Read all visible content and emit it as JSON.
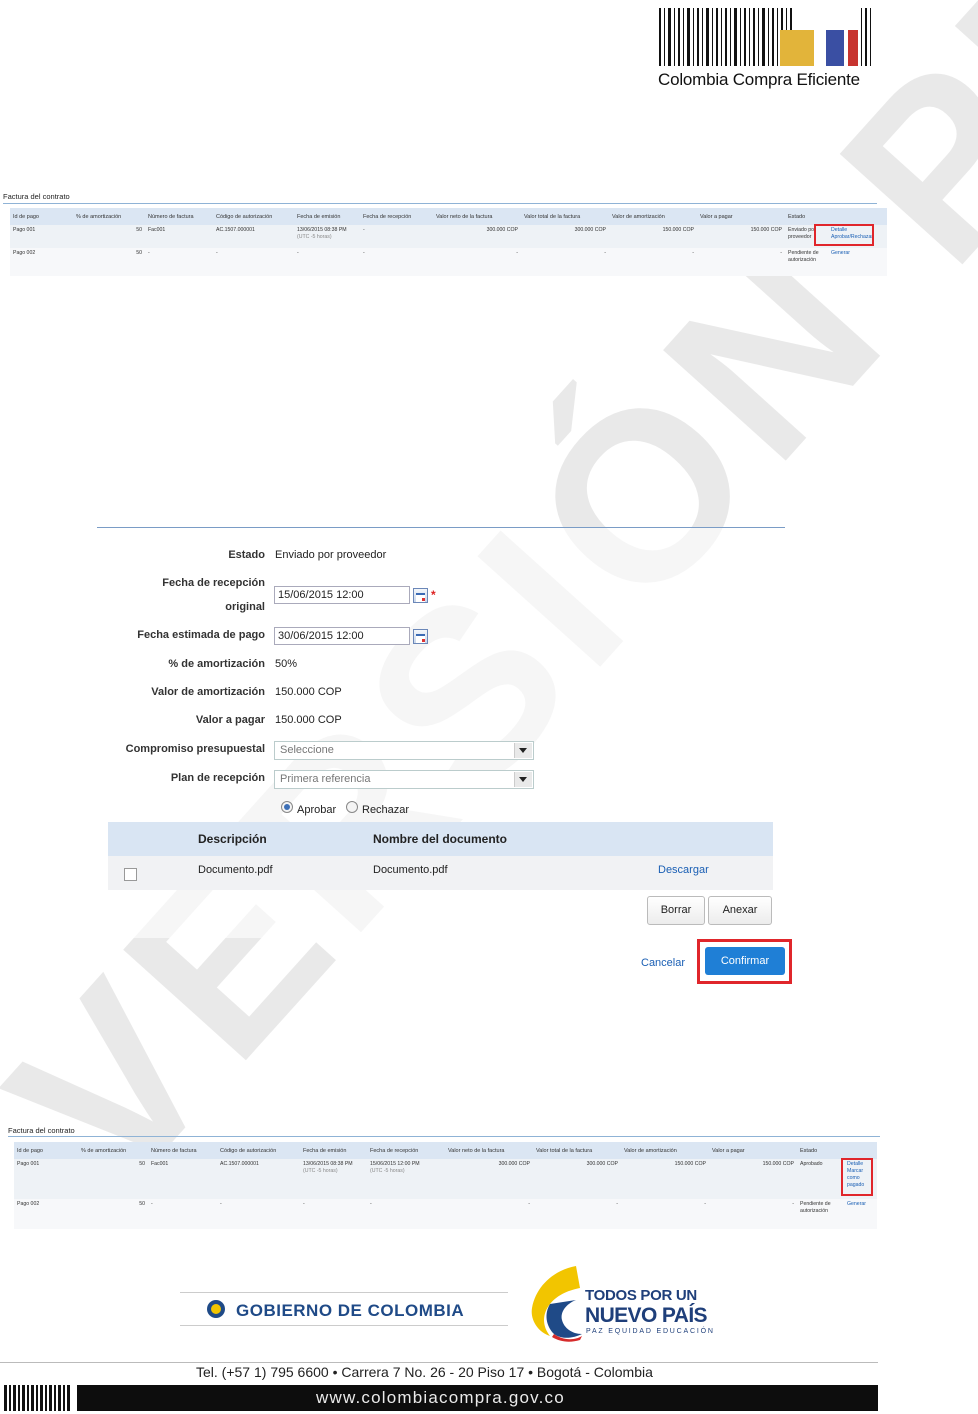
{
  "header": {
    "brand": "Colombia Compra Eficiente"
  },
  "table_before": {
    "title": "Factura del contrato",
    "columns": [
      "Id de pago",
      "% de amortización",
      "Número de factura",
      "Código de autorización",
      "Fecha de emisión",
      "Fecha de recepción",
      "Valor neto de la factura",
      "Valor total de la factura",
      "Valor de amortización",
      "Valor a pagar",
      "Estado"
    ],
    "rows": [
      {
        "id": "Pago 001",
        "pct": "50",
        "num": "Fac001",
        "code": "AC.1507.000001",
        "emision": "13/06/2015 08:38 PM",
        "emision_tz": "(UTC -5 horas)",
        "recepcion": "-",
        "neto": "300.000 COP",
        "total": "300.000 COP",
        "amort": "150.000 COP",
        "pagar": "150.000 COP",
        "estado": "Enviado por proveedor",
        "actions": [
          "Detalle",
          "Aprobar/Rechazar"
        ]
      },
      {
        "id": "Pago 002",
        "pct": "50",
        "num": "-",
        "code": "-",
        "emision": "-",
        "recepcion": "-",
        "neto": "-",
        "total": "-",
        "amort": "-",
        "pagar": "-",
        "estado": "Pendiente de autorización",
        "actions": [
          "Generar"
        ]
      }
    ]
  },
  "dialog": {
    "estado_label": "Estado",
    "estado_value": "Enviado por proveedor",
    "fecha_recepcion_label_1": "Fecha de recepción",
    "fecha_recepcion_label_2": "original",
    "fecha_recepcion_value": "15/06/2015 12:00",
    "required_mark": "*",
    "fecha_pago_label": "Fecha estimada de pago",
    "fecha_pago_value": "30/06/2015 12:00",
    "pct_label": "% de amortización",
    "pct_value": "50%",
    "amort_label": "Valor de amortización",
    "amort_value": "150.000 COP",
    "pagar_label": "Valor a pagar",
    "pagar_value": "150.000 COP",
    "compromiso_label": "Compromiso presupuestal",
    "compromiso_value": "Seleccione",
    "plan_label": "Plan de recepción",
    "plan_value": "Primera referencia",
    "aprobar": "Aprobar",
    "rechazar": "Rechazar",
    "doc_headers": {
      "descripcion": "Descripción",
      "nombre": "Nombre del documento"
    },
    "doc_row": {
      "descripcion": "Documento.pdf",
      "nombre": "Documento.pdf",
      "accion": "Descargar"
    },
    "borrar": "Borrar",
    "anexar": "Anexar",
    "cancelar": "Cancelar",
    "confirmar": "Confirmar"
  },
  "table_after": {
    "title": "Factura del contrato",
    "columns": [
      "Id de pago",
      "% de amortización",
      "Número de factura",
      "Código de autorización",
      "Fecha de emisión",
      "Fecha de recepción",
      "Valor neto de la factura",
      "Valor total de la factura",
      "Valor de amortización",
      "Valor a pagar",
      "Estado"
    ],
    "rows": [
      {
        "id": "Pago 001",
        "pct": "50",
        "num": "Fac001",
        "code": "AC.1507.000001",
        "emision": "13/06/2015 08:38 PM",
        "emision_tz": "(UTC -5 horas)",
        "recepcion": "15/06/2015 12:00 PM",
        "recepcion_tz": "(UTC -5 horas)",
        "neto": "300.000 COP",
        "total": "300.000 COP",
        "amort": "150.000 COP",
        "pagar": "150.000 COP",
        "estado": "Aprobado",
        "actions": [
          "Detalle",
          "Marcar como pagado"
        ]
      },
      {
        "id": "Pago 002",
        "pct": "50",
        "num": "-",
        "code": "-",
        "emision": "-",
        "recepcion": "-",
        "neto": "-",
        "total": "-",
        "amort": "-",
        "pagar": "-",
        "estado": "Pendiente de autorización",
        "actions": [
          "Generar"
        ]
      }
    ]
  },
  "watermark": "VERSIÓN PRELIMINAR",
  "footer": {
    "gobierno": "GOBIERNO DE COLOMBIA",
    "todos_1": "TODOS POR UN",
    "todos_2": "NUEVO PAÍS",
    "todos_3": "PAZ  EQUIDAD  EDUCACIÓN",
    "tel": "Tel. (+57 1) 795 6600 • Carrera 7 No. 26 - 20 Piso 17 • Bogotá - Colombia",
    "web": "www.colombiacompra.gov.co"
  }
}
